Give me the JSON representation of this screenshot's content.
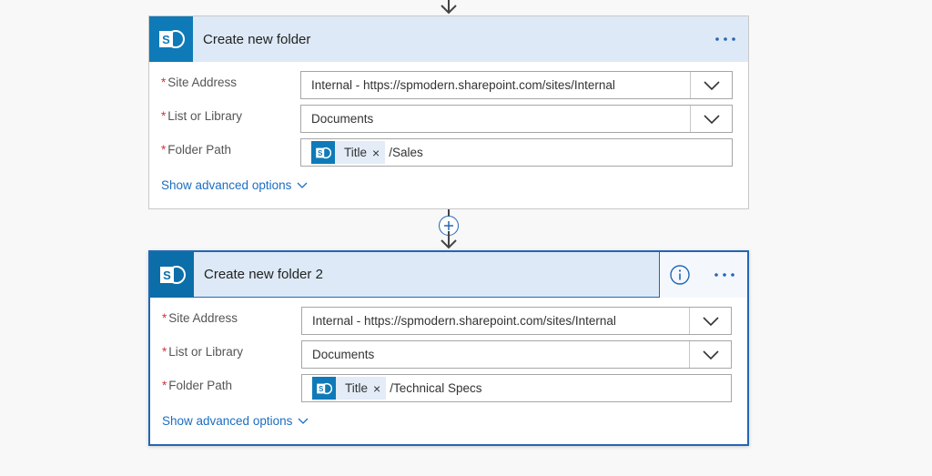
{
  "steps": [
    {
      "title": "Create new folder",
      "fields": {
        "site_address": {
          "label": "Site Address",
          "required_mark": "*",
          "value": "Internal - https://spmodern.sharepoint.com/sites/Internal"
        },
        "list_or_library": {
          "label": "List or Library",
          "required_mark": "*",
          "value": "Documents"
        },
        "folder_path": {
          "label": "Folder Path",
          "required_mark": "*",
          "token": "Title",
          "token_remove": "×",
          "path": "/Sales"
        }
      },
      "advanced_link": "Show advanced options"
    },
    {
      "title": "Create new folder 2",
      "fields": {
        "site_address": {
          "label": "Site Address",
          "required_mark": "*",
          "value": "Internal - https://spmodern.sharepoint.com/sites/Internal"
        },
        "list_or_library": {
          "label": "List or Library",
          "required_mark": "*",
          "value": "Documents"
        },
        "folder_path": {
          "label": "Folder Path",
          "required_mark": "*",
          "token": "Title",
          "token_remove": "×",
          "path": "/Technical Specs"
        }
      },
      "advanced_link": "Show advanced options"
    }
  ],
  "colors": {
    "accent": "#2266b5",
    "sharepoint": "#0f7ab8",
    "header_bg": "#dde9f6",
    "required": "#d13438",
    "link": "#1b6ec2"
  },
  "icons": {
    "sharepoint": "sharepoint-logo-icon",
    "more": "more-options-icon",
    "info": "info-icon",
    "chevron": "chevron-down-icon",
    "add": "plus-icon",
    "arrow": "arrow-down-icon"
  }
}
